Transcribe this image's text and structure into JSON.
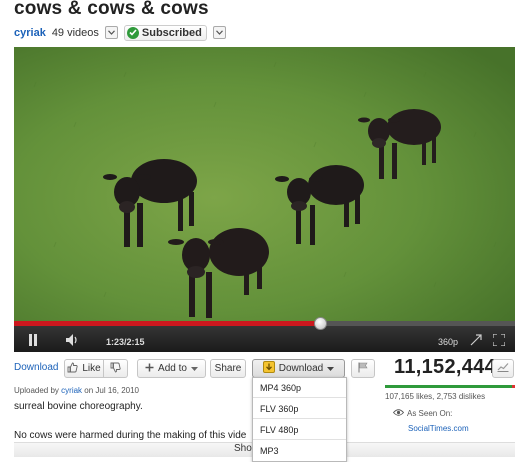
{
  "title": "cows & cows & cows",
  "channel": {
    "name": "cyriak",
    "video_count": "49 videos",
    "subscribe_label": "Subscribed"
  },
  "player": {
    "time_current": "1:23",
    "time_total": "2:15",
    "time_separator": "/",
    "progress_fraction": 0.61,
    "quality": "360p"
  },
  "actions": {
    "download_link": "Download",
    "like": "Like",
    "add_to": "Add to",
    "share": "Share",
    "download_button": "Download"
  },
  "download_menu": {
    "items": [
      "MP4 360p",
      "FLV 360p",
      "FLV 480p",
      "MP3"
    ]
  },
  "stats": {
    "views": "11,152,444",
    "likes_dislikes": "107,165 likes, 2,753 dislikes",
    "like_fraction": 0.975,
    "seen_on": "As Seen On:",
    "seen_on_site": "SocialTimes.com"
  },
  "uploader": {
    "prefix": "Uploaded by",
    "user": "cyriak",
    "date_text": "on Jul 16, 2010"
  },
  "description": {
    "line1": "surreal bovine choreography.",
    "line2": "No cows were harmed during the making of this vide"
  },
  "show_more": "Sho",
  "colors": {
    "link": "#1c62b9",
    "progress": "#cc181e",
    "likes": "#2f9a3b",
    "dislikes": "#dd3333",
    "grass": "#5f8c34"
  }
}
